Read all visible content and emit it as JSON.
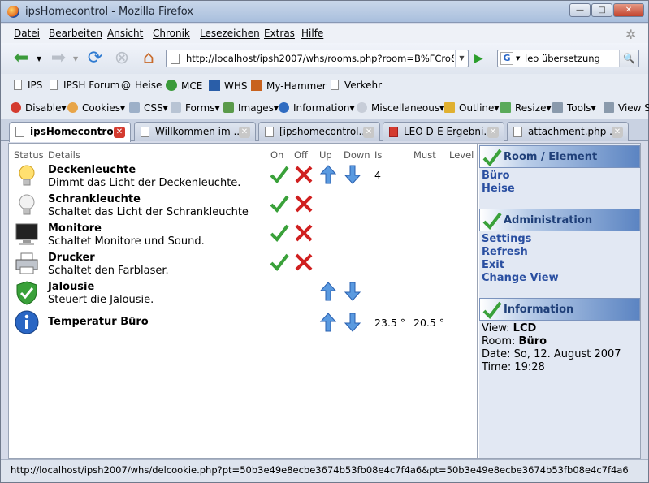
{
  "window": {
    "title": "ipsHomecontrol - Mozilla Firefox"
  },
  "menu": [
    "Datei",
    "Bearbeiten",
    "Ansicht",
    "Chronik",
    "Lesezeichen",
    "Extras",
    "Hilfe"
  ],
  "nav": {
    "url": "http://localhost/ipsh2007/whs/rooms.php?room=B%FCro&ri",
    "search": "leo übersetzung"
  },
  "bookmarks": [
    "IPS",
    "IPSH Forum",
    "Heise",
    "MCE",
    "WHS",
    "My-Hammer",
    "Verkehr"
  ],
  "devtools": [
    "Disable",
    "Cookies",
    "CSS",
    "Forms",
    "Images",
    "Information",
    "Miscellaneous",
    "Outline",
    "Resize",
    "Tools",
    "View S"
  ],
  "tabs": [
    "ipsHomecontrol",
    "Willkommen im ...",
    "[ipshomecontrol...",
    "LEO D-E Ergebni...",
    "attachment.php ..."
  ],
  "table": {
    "headers": [
      "Status",
      "Details",
      "On",
      "Off",
      "Up",
      "Down",
      "Is",
      "Must",
      "Level"
    ],
    "rows": [
      {
        "name": "Deckenleuchte",
        "desc": "Dimmt das Licht der Deckenleuchte.",
        "icon": "light-bulb-on-icon",
        "is": "4"
      },
      {
        "name": "Schrankleuchte",
        "desc": "Schaltet das Licht der Schrankleuchte",
        "icon": "light-bulb-off-icon"
      },
      {
        "name": "Monitore",
        "desc": "Schaltet Monitore und Sound.",
        "icon": "monitor-icon"
      },
      {
        "name": "Drucker",
        "desc": "Schaltet den Farblaser.",
        "icon": "printer-icon"
      },
      {
        "name": "Jalousie",
        "desc": "Steuert die Jalousie.",
        "icon": "shield-check-icon"
      },
      {
        "name": "Temperatur Büro",
        "desc": "",
        "icon": "info-icon",
        "is": "23.5 °",
        "must": "20.5 °"
      }
    ]
  },
  "side": {
    "room": {
      "title": "Room / Element",
      "links": [
        "Büro",
        "Heise"
      ]
    },
    "admin": {
      "title": "Administration",
      "links": [
        "Settings",
        "Refresh",
        "Exit",
        "Change View"
      ]
    },
    "info": {
      "title": "Information",
      "view_label": "View:",
      "view": "LCD",
      "room_label": "Room:",
      "room": "Büro",
      "date_label": "Date:",
      "date": "So, 12. August 2007",
      "time_label": "Time:",
      "time": "19:28"
    }
  },
  "status": "http://localhost/ipsh2007/whs/delcookie.php?pt=50b3e49e8ecbe3674b53fb08e4c7f4a6&pt=50b3e49e8ecbe3674b53fb08e4c7f4a6"
}
